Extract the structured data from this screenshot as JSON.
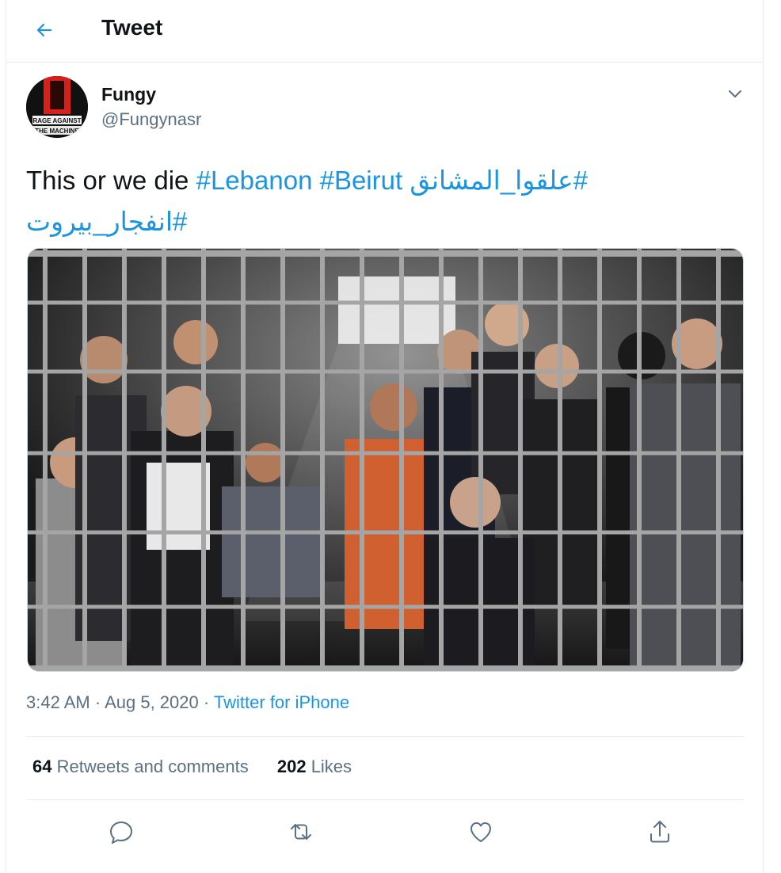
{
  "header": {
    "title": "Tweet"
  },
  "author": {
    "name": "Fungy",
    "handle": "@Fungynasr"
  },
  "avatar_logo_text": [
    "RAGE AGAINST",
    "THE MACHINE"
  ],
  "tweet": {
    "text_before": "This or we die ",
    "hashtags": [
      "#Lebanon",
      "#Beirut",
      "#علقوا_المشانق",
      "#انفجار_بيروت"
    ]
  },
  "meta": {
    "time": "3:42 AM",
    "sep1": "·",
    "date": "Aug 5, 2020",
    "sep2": "·",
    "source": "Twitter for iPhone"
  },
  "stats": {
    "retweets_count": "64",
    "retweets_label": "Retweets and comments",
    "likes_count": "202",
    "likes_label": "Likes"
  },
  "icons": {
    "back": "arrow-left-icon",
    "caret": "chevron-down-icon",
    "reply": "reply-icon",
    "retweet": "retweet-icon",
    "like": "heart-icon",
    "share": "share-icon"
  },
  "colors": {
    "accent": "#1b95e0",
    "muted": "#5b7083",
    "border": "#e6ecf0",
    "text": "#0f1419"
  }
}
